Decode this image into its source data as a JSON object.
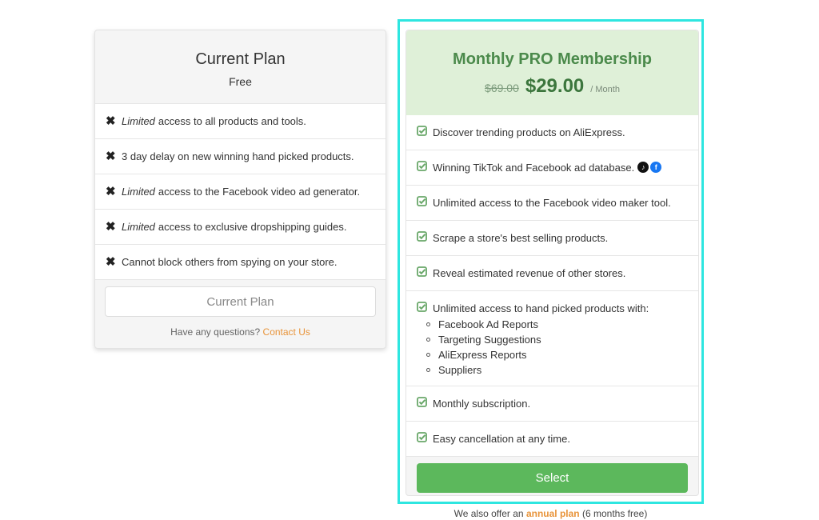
{
  "free_plan": {
    "title": "Current Plan",
    "subtitle": "Free",
    "features": [
      {
        "icon": "x-icon",
        "emphasis": "Limited",
        "text": "access to all products and tools."
      },
      {
        "icon": "x-icon",
        "emphasis": "",
        "text": "3 day delay on new winning hand picked products."
      },
      {
        "icon": "x-icon",
        "emphasis": "Limited",
        "text": "access to the Facebook video ad generator."
      },
      {
        "icon": "x-icon",
        "emphasis": "Limited",
        "text": "access to exclusive dropshipping guides."
      },
      {
        "icon": "x-icon",
        "emphasis": "",
        "text": "Cannot block others from spying on your store."
      }
    ],
    "button_label": "Current Plan",
    "question_text": "Have any questions?",
    "contact_link": "Contact Us"
  },
  "pro_plan": {
    "title": "Monthly PRO Membership",
    "old_price": "$69.00",
    "price": "$29.00",
    "period": "/ Month",
    "features": [
      {
        "text": "Discover trending products on AliExpress."
      },
      {
        "text": "Winning TikTok and Facebook ad database."
      },
      {
        "text": "Unlimited access to the Facebook video maker tool."
      },
      {
        "text": "Scrape a store's best selling products."
      },
      {
        "text": "Reveal estimated revenue of other stores."
      },
      {
        "text": "Unlimited access to hand picked products with:",
        "sub_items": [
          "Facebook Ad Reports",
          "Targeting Suggestions",
          "AliExpress Reports",
          "Suppliers"
        ]
      },
      {
        "text": "Monthly subscription."
      },
      {
        "text": "Easy cancellation at any time."
      }
    ],
    "social_icons": {
      "tiktok": "♪",
      "facebook": "f"
    },
    "button_label": "Select"
  },
  "annual_note": {
    "prefix": "We also offer an",
    "link": "annual plan",
    "suffix": "(6 months free)"
  },
  "colors": {
    "accent_green": "#5cb85c",
    "title_green": "#4b8a4b",
    "header_green_bg": "#dff0d8",
    "link_orange": "#e8943a",
    "highlight_cyan": "#2ee6e0"
  }
}
